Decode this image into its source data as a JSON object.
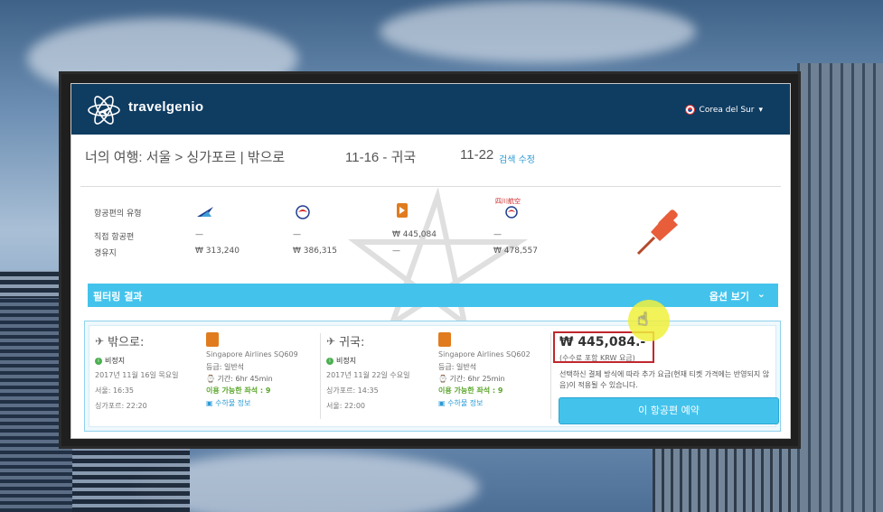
{
  "header": {
    "brand": "travelgenio",
    "country": "Corea del Sur",
    "country_caret": "▾"
  },
  "trip": {
    "title": "너의 여행: 서울 > 싱가포르 | 밖으로",
    "outbound_date": "11-16 - 귀국",
    "return_date": "11-22",
    "edit_link": "검색 수정"
  },
  "comparison": {
    "row_labels": [
      "항공편의 유형",
      "직접 항공편",
      "경유지"
    ],
    "columns": [
      {
        "logo": "korean-air-logo",
        "direct": "—",
        "stops": "₩ 313,240"
      },
      {
        "logo": "china-eastern-logo",
        "direct": "—",
        "stops": "₩ 386,315"
      },
      {
        "logo": "singapore-airlines-logo",
        "direct": "₩ 445,084",
        "stops": "—"
      },
      {
        "logo": "sichuan-airlines-logo",
        "direct": "—",
        "stops": "₩ 478,557"
      }
    ]
  },
  "filter_bar": {
    "title": "필터링 결과",
    "options": "옵션 보기",
    "chevron": "⌄"
  },
  "result": {
    "outbound": {
      "heading": "밖으로:",
      "stops": "비정지",
      "date": "2017년 11월 16일 목요일",
      "depart": "서울: 16:35",
      "arrive": "싱가포르: 22:20",
      "airline": "Singapore Airlines SQ609",
      "class": "등급: 일반석",
      "duration": "기간: 6hr 45min",
      "seats": "이용 가능한 좌석 : 9",
      "baggage": "수하물 정보"
    },
    "return": {
      "heading": "귀국:",
      "stops": "비정지",
      "date": "2017년 11월 22일 수요일",
      "depart": "싱가포르: 14:35",
      "arrive": "서울: 22:00",
      "airline": "Singapore Airlines SQ602",
      "class": "등급: 일반석",
      "duration": "기간: 6hr 25min",
      "seats": "이용 가능한 좌석 : 9",
      "baggage": "수하물 정보"
    },
    "price": "₩ 445,084.-",
    "price_note": "(수수료 포함 KRW 요금)",
    "payment_note": "선택하신 결제 방식에 따라 추가 요금(현재 티켓 가격에는 반영되지 않음)이 적용될 수 있습니다.",
    "book_button": "이 항공편 예약"
  },
  "colors": {
    "navbar": "#0f3c61",
    "accent": "#43c3ec",
    "price_border": "#c0272d",
    "seats_green": "#5aa52a",
    "pin": "#e85d3a"
  }
}
